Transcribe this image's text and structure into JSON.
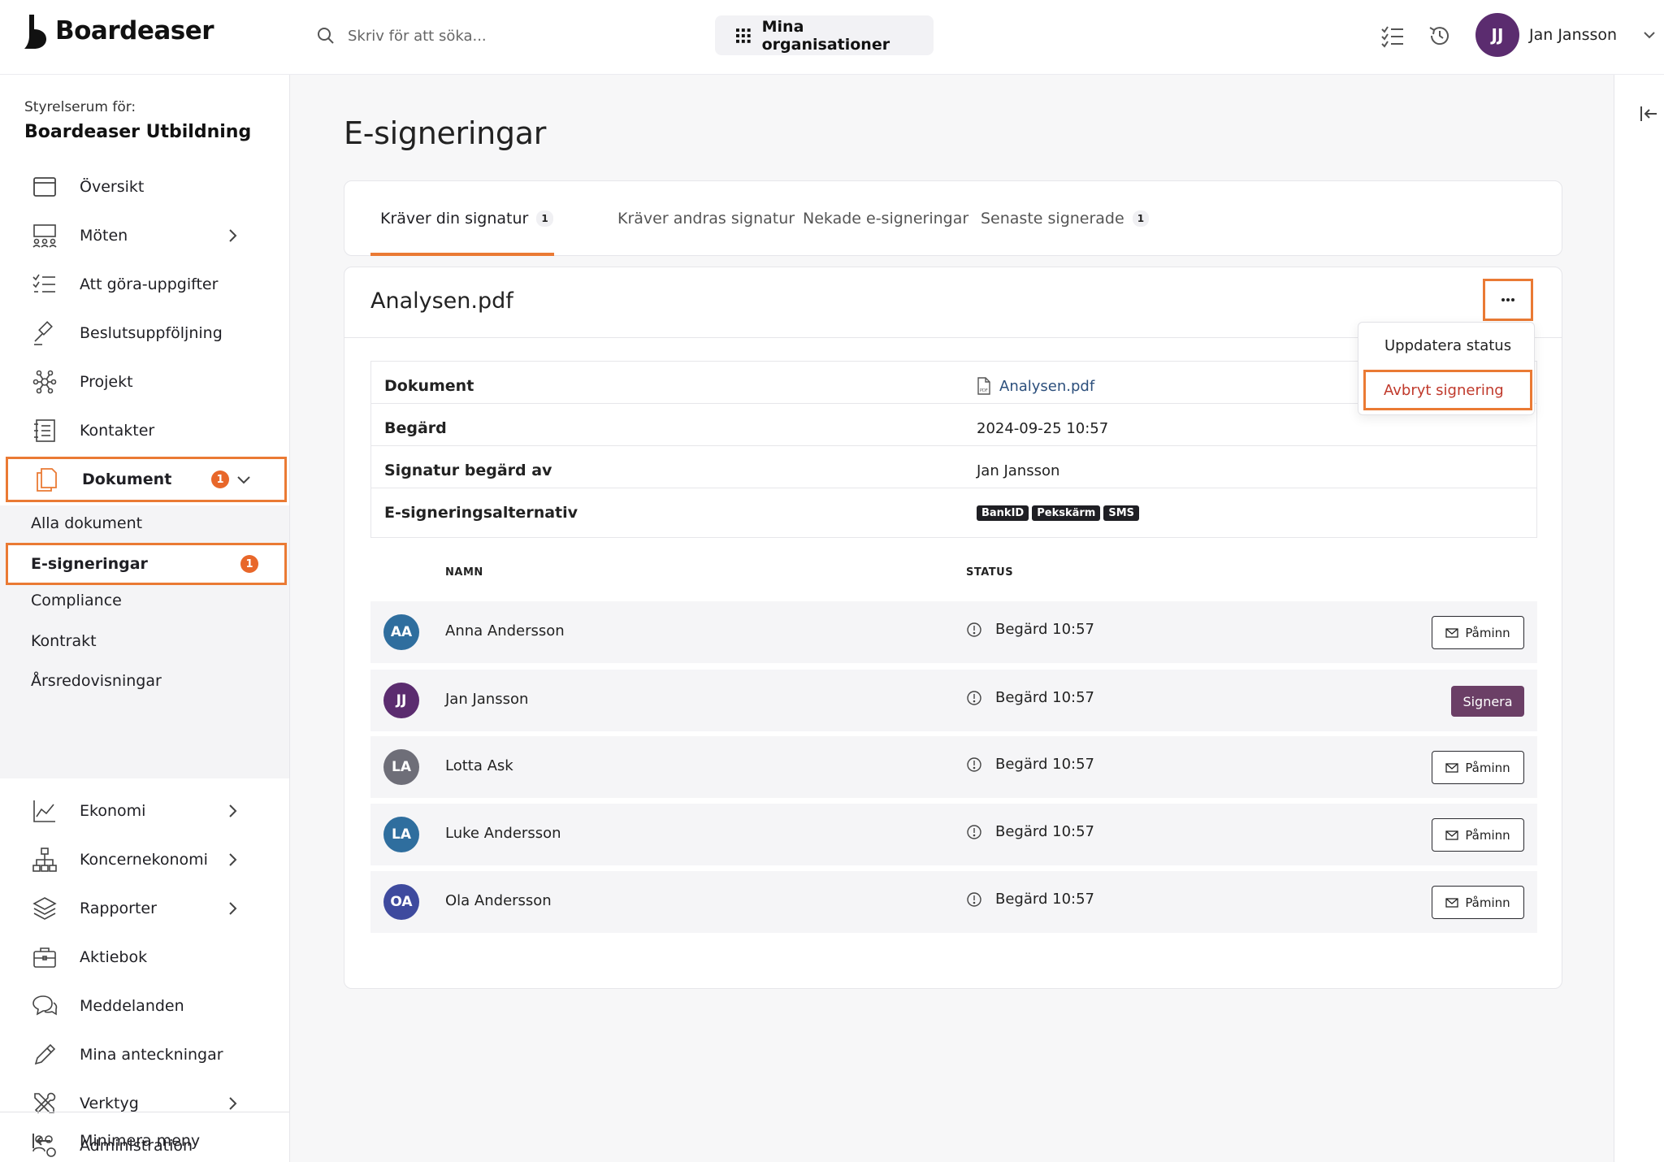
{
  "app": {
    "brand": "Boardeaser",
    "search_placeholder": "Skriv för att söka...",
    "org_button": "Mina organisationer",
    "user_initials": "JJ",
    "user_name": "Jan Jansson"
  },
  "sidebar": {
    "room_label": "Styrelserum för:",
    "room_name": "Boardeaser Utbildning",
    "items": [
      {
        "label": "Översikt",
        "icon": "overview-icon"
      },
      {
        "label": "Möten",
        "icon": "meetings-icon"
      },
      {
        "label": "Att göra-uppgifter",
        "icon": "tasks-icon"
      },
      {
        "label": "Beslutsuppföljning",
        "icon": "gavel-icon"
      },
      {
        "label": "Projekt",
        "icon": "network-icon"
      },
      {
        "label": "Kontakter",
        "icon": "contacts-icon"
      },
      {
        "label": "Dokument",
        "icon": "documents-icon",
        "badge": "1"
      },
      {
        "label": "Ekonomi",
        "icon": "chart-icon"
      },
      {
        "label": "Koncernekonomi",
        "icon": "org-tree-icon"
      },
      {
        "label": "Rapporter",
        "icon": "layers-icon"
      },
      {
        "label": "Aktiebok",
        "icon": "briefcase-icon"
      },
      {
        "label": "Meddelanden",
        "icon": "chat-icon"
      },
      {
        "label": "Mina anteckningar",
        "icon": "pencil-icon"
      },
      {
        "label": "Verktyg",
        "icon": "tools-icon"
      },
      {
        "label": "Administration",
        "icon": "admin-icon"
      }
    ],
    "sub_items": [
      "Alla dokument",
      "E-signeringar",
      "Compliance",
      "Kontrakt",
      "Årsredovisningar"
    ],
    "sub_active_badge": "1",
    "minimize": "Minimera meny"
  },
  "main": {
    "title": "E-signeringar",
    "tabs": [
      {
        "label": "Kräver din signatur",
        "count": "1"
      },
      {
        "label": "Kräver andras signatur"
      },
      {
        "label": "Nekade e-signeringar"
      },
      {
        "label": "Senaste signerade",
        "count": "1"
      }
    ],
    "doc": {
      "title": "Analysen.pdf",
      "rows": [
        {
          "label": "Dokument",
          "value": "Analysen.pdf"
        },
        {
          "label": "Begärd",
          "value": "2024-09-25 10:57"
        },
        {
          "label": "Signatur begärd av",
          "value": "Jan Jansson"
        },
        {
          "label": "E-signeringsalternativ",
          "options": [
            "BankID",
            "Pekskärm",
            "SMS"
          ]
        }
      ],
      "col_name": "NAMN",
      "col_status": "STATUS",
      "signers": [
        {
          "initials": "AA",
          "name": "Anna Andersson",
          "status": "Begärd 10:57",
          "action": "Påminn",
          "color": "#2f6e9e"
        },
        {
          "initials": "JJ",
          "name": "Jan Jansson",
          "status": "Begärd 10:57",
          "action": "Signera",
          "color": "#5b2c6f"
        },
        {
          "initials": "LA",
          "name": "Lotta Ask",
          "status": "Begärd 10:57",
          "action": "Påminn",
          "color": "#6e6e78"
        },
        {
          "initials": "LA",
          "name": "Luke Andersson",
          "status": "Begärd 10:57",
          "action": "Påminn",
          "color": "#2f6e9e"
        },
        {
          "initials": "OA",
          "name": "Ola Andersson",
          "status": "Begärd 10:57",
          "action": "Påminn",
          "color": "#3e4a9e"
        }
      ]
    },
    "menu": {
      "update": "Uppdatera status",
      "cancel": "Avbryt signering"
    }
  },
  "colors": {
    "accent": "#ea7a34",
    "badge": "#e8672a",
    "sign_button": "#6b3f66",
    "danger_text": "#c0392b"
  }
}
